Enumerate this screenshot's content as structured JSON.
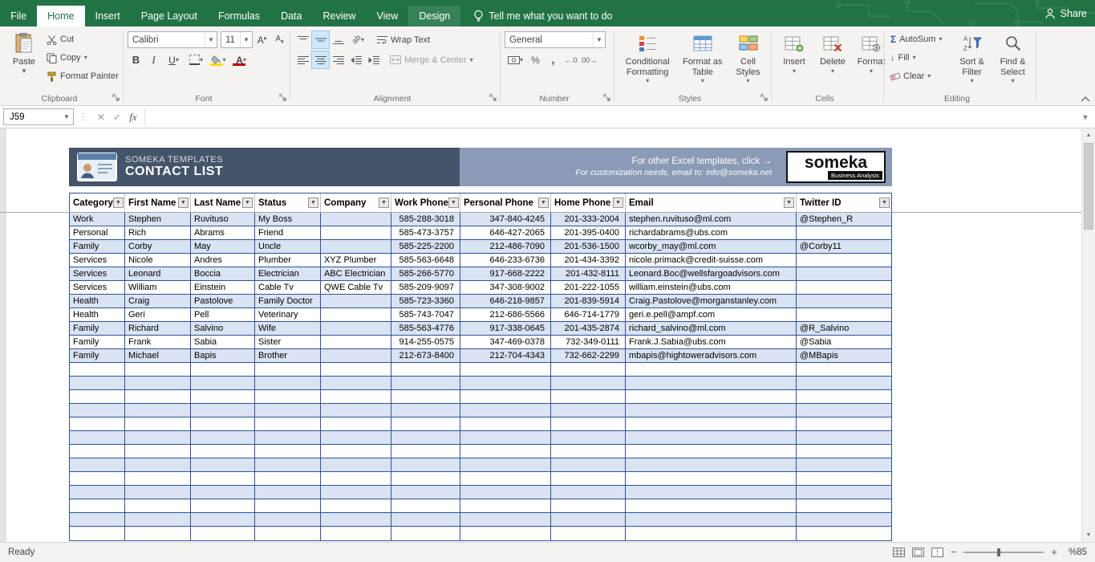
{
  "tabs": {
    "items": [
      {
        "label": "File",
        "type": "file"
      },
      {
        "label": "Home",
        "type": "active"
      },
      {
        "label": "Insert",
        "type": "normal"
      },
      {
        "label": "Page Layout",
        "type": "normal"
      },
      {
        "label": "Formulas",
        "type": "normal"
      },
      {
        "label": "Data",
        "type": "normal"
      },
      {
        "label": "Review",
        "type": "normal"
      },
      {
        "label": "View",
        "type": "normal"
      },
      {
        "label": "Design",
        "type": "contextual"
      }
    ],
    "tell_me": "Tell me what you want to do",
    "share": "Share"
  },
  "ribbon": {
    "clipboard": {
      "label": "Clipboard",
      "paste": "Paste",
      "cut": "Cut",
      "copy": "Copy",
      "format_painter": "Format Painter"
    },
    "font": {
      "label": "Font",
      "family": "Calibri",
      "size": "11",
      "bold": "B",
      "italic": "I",
      "underline": "U"
    },
    "alignment": {
      "label": "Alignment",
      "wrap_text": "Wrap Text",
      "merge_center": "Merge & Center"
    },
    "number": {
      "label": "Number",
      "format": "General"
    },
    "styles": {
      "label": "Styles",
      "conditional": "Conditional Formatting",
      "format_table": "Format as Table",
      "cell_styles": "Cell Styles"
    },
    "cells": {
      "label": "Cells",
      "insert": "Insert",
      "delete": "Delete",
      "format": "Format"
    },
    "editing": {
      "label": "Editing",
      "autosum": "AutoSum",
      "fill": "Fill",
      "clear": "Clear",
      "sort_filter": "Sort & Filter",
      "find_select": "Find & Select"
    }
  },
  "formula_bar": {
    "name_box": "J59",
    "fx": "fx",
    "formula": ""
  },
  "sheet": {
    "header": {
      "brand": "SOMEKA TEMPLATES",
      "title": "CONTACT LIST",
      "promo_line1": "For other Excel templates, click →",
      "promo_line2": "For customization needs, email to: info@someka.net",
      "logo_text": "someka",
      "logo_sub": "Business Analysis"
    },
    "columns": [
      "Category",
      "First Name",
      "Last Name",
      "Status",
      "Company",
      "Work Phone",
      "Personal Phone",
      "Home Phone",
      "Email",
      "Twitter ID"
    ],
    "rows": [
      [
        "Work",
        "Stephen",
        "Ruvituso",
        "My Boss",
        "",
        "585-288-3018",
        "347-840-4245",
        "201-333-2004",
        "stephen.ruvituso@ml.com",
        "@Stephen_R"
      ],
      [
        "Personal",
        "Rich",
        "Abrams",
        "Friend",
        "",
        "585-473-3757",
        "646-427-2065",
        "201-395-0400",
        "richardabrams@ubs.com",
        ""
      ],
      [
        "Family",
        "Corby",
        "May",
        "Uncle",
        "",
        "585-225-2200",
        "212-486-7090",
        "201-536-1500",
        "wcorby_may@ml.com",
        "@Corby11"
      ],
      [
        "Services",
        "Nicole",
        "Andres",
        "Plumber",
        "XYZ Plumber",
        "585-563-6648",
        "646-233-6736",
        "201-434-3392",
        "nicole.primack@credit-suisse.com",
        ""
      ],
      [
        "Services",
        "Leonard",
        "Boccia",
        "Electrician",
        "ABC Electrician",
        "585-266-5770",
        "917-668-2222",
        "201-432-8111",
        "Leonard.Boc@wellsfargoadvisors.com",
        ""
      ],
      [
        "Services",
        "William",
        "Einstein",
        "Cable Tv",
        "QWE Cable Tv",
        "585-209-9097",
        "347-308-9002",
        "201-222-1055",
        "william.einstein@ubs.com",
        ""
      ],
      [
        "Health",
        "Craig",
        "Pastolove",
        "Family Doctor",
        "",
        "585-723-3360",
        "646-218-9857",
        "201-839-5914",
        "Craig.Pastolove@morganstanley.com",
        ""
      ],
      [
        "Health",
        "Geri",
        "Pell",
        "Veterinary",
        "",
        "585-743-7047",
        "212-686-5566",
        "646-714-1779",
        "geri.e.pell@ampf.com",
        ""
      ],
      [
        "Family",
        "Richard",
        "Salvino",
        "Wife",
        "",
        "585-563-4776",
        "917-338-0645",
        "201-435-2874",
        "richard_salvino@ml.com",
        "@R_Salvino"
      ],
      [
        "Family",
        "Frank",
        "Sabia",
        "Sister",
        "",
        "914-255-0575",
        "347-469-0378",
        "732-349-0111",
        "Frank.J.Sabia@ubs.com",
        "@Sabia"
      ],
      [
        "Family",
        "Michael",
        "Bapis",
        "Brother",
        "",
        "212-673-8400",
        "212-704-4343",
        "732-662-2299",
        "mbapis@hightoweradvisors.com",
        "@MBapis"
      ]
    ],
    "empty_rows": 13
  },
  "status_bar": {
    "mode": "Ready",
    "zoom": "%85"
  }
}
